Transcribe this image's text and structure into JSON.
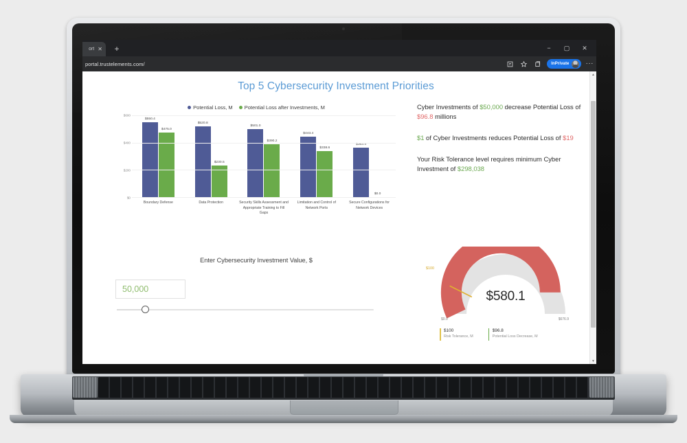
{
  "browser": {
    "tab_title": "ort",
    "tab_close_glyph": "✕",
    "new_tab_glyph": "+",
    "window_minimize": "−",
    "window_maximize": "▢",
    "window_close": "✕",
    "url": "portal.trustelements.com/",
    "inprivate_label": "InPrivate",
    "overflow_glyph": "···",
    "scroll_up_glyph": "▲",
    "scroll_down_glyph": "▼"
  },
  "page": {
    "title": "Top 5 Cybersecurity Investment Priorities"
  },
  "chart_data": {
    "type": "bar",
    "title": "Top 5 Cybersecurity Investment Priorities",
    "xlabel": "",
    "ylabel": "",
    "ylim": [
      0,
      600
    ],
    "yticks": [
      "$0",
      "$200",
      "$400",
      "$600"
    ],
    "grid": true,
    "legend_position": "top-center",
    "categories": [
      "Boundary Defense",
      "Data Protection",
      "Security Skills Assessment and Appropriate Training to Fill Gaps",
      "Limitation and Control of Network Ports",
      "Secure Configurations for Network Devices"
    ],
    "series": [
      {
        "name": "Potential Loss, M",
        "color": "#4f5b96",
        "values": [
          550.4,
          520.8,
          501.0,
          443.4,
          363.4
        ],
        "labels": [
          "$550.4",
          "$520.8",
          "$501.0",
          "$443.4",
          "$363.4"
        ]
      },
      {
        "name": "Potential Loss after Investments, M",
        "color": "#6aab4a",
        "values": [
          475.0,
          230.5,
          390.2,
          338.6,
          0.0
        ],
        "labels": [
          "$475.0",
          "$230.5",
          "$390.2",
          "$338.6",
          "$0.0"
        ]
      }
    ]
  },
  "insights": [
    {
      "parts": [
        {
          "t": "Cyber Investments of ",
          "style": "plain"
        },
        {
          "t": "$50,000",
          "style": "green"
        },
        {
          "t": " decrease Potential Loss of ",
          "style": "plain"
        },
        {
          "t": "$96.8",
          "style": "red"
        },
        {
          "t": " millions",
          "style": "plain"
        }
      ]
    },
    {
      "parts": [
        {
          "t": "$1",
          "style": "green"
        },
        {
          "t": " of Cyber Investments reduces Potential Loss of ",
          "style": "plain"
        },
        {
          "t": "$19",
          "style": "red"
        }
      ]
    },
    {
      "parts": [
        {
          "t": "Your Risk Tolerance level requires minimum Cyber Investment of ",
          "style": "plain"
        },
        {
          "t": "$298,038",
          "style": "green"
        }
      ]
    }
  ],
  "slider": {
    "label": "Enter Cybersecurity Investment Value, $",
    "value": "50,000",
    "placeholder": "0",
    "percent": 11
  },
  "gauge": {
    "value": "$580.1",
    "min_label": "$0.0",
    "max_label": "$676.9",
    "target_label": "$100",
    "min": 0,
    "max": 676.9,
    "current": 580.1,
    "target": 100,
    "arc_color": "#d4635e",
    "track_color": "#e3e3e3",
    "target_color": "#e0b030",
    "legend": [
      {
        "value": "$100",
        "label": "Risk Tolerance, M",
        "color": "#e0c24a"
      },
      {
        "value": "$96.8",
        "label": "Potential Loss Decrease, M",
        "color": "#6aab4a"
      }
    ]
  },
  "colors": {
    "title_blue": "#5b9bd5",
    "series_1": "#4f5b96",
    "series_2": "#6aab4a",
    "green_text": "#6aa84f",
    "red_text": "#e06666",
    "accent": "#1a73e8"
  }
}
